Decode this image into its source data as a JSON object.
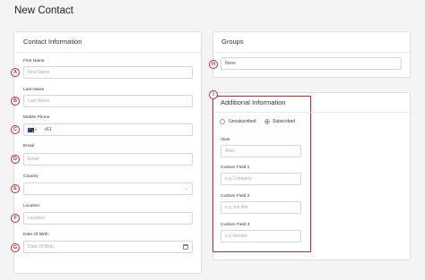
{
  "page": {
    "title": "New Contact"
  },
  "contact_info": {
    "title": "Contact Information",
    "fields": [
      {
        "marker": "A",
        "label": "First Name",
        "placeholder": "First Name"
      },
      {
        "marker": "B",
        "label": "Last Name",
        "placeholder": "Last Name"
      },
      {
        "marker": "C",
        "label": "Mobile Phone",
        "dial_code": "+61",
        "flag_icon": "australia-flag-icon"
      },
      {
        "marker": "D",
        "label": "Email",
        "placeholder": "Email"
      },
      {
        "marker": "E",
        "label": "Country",
        "value": "",
        "icon": "chevron-down-icon"
      },
      {
        "marker": "F",
        "label": "Location",
        "placeholder": "Location"
      },
      {
        "marker": "G",
        "label": "Date Of Birth",
        "placeholder": "Date Of Birth",
        "icon": "calendar-icon"
      }
    ]
  },
  "groups": {
    "title": "Groups",
    "marker": "H",
    "value": "None"
  },
  "additional_info": {
    "marker": "I",
    "title": "Additional Information",
    "subscription": {
      "options": [
        "Unsubscribed",
        "Subscribed"
      ],
      "selected": "Subscribed"
    },
    "fields": [
      {
        "label": "Alias",
        "placeholder": "Alias"
      },
      {
        "label": "Custom Field 1",
        "placeholder": "e.g Company"
      },
      {
        "label": "Custom Field 2",
        "placeholder": "e.g Job title"
      },
      {
        "label": "Custom Field 3",
        "placeholder": "e.g Gender"
      }
    ]
  },
  "colors": {
    "marker": "#c0282d",
    "border": "#d6d6d6",
    "background": "#f4f4f4"
  }
}
